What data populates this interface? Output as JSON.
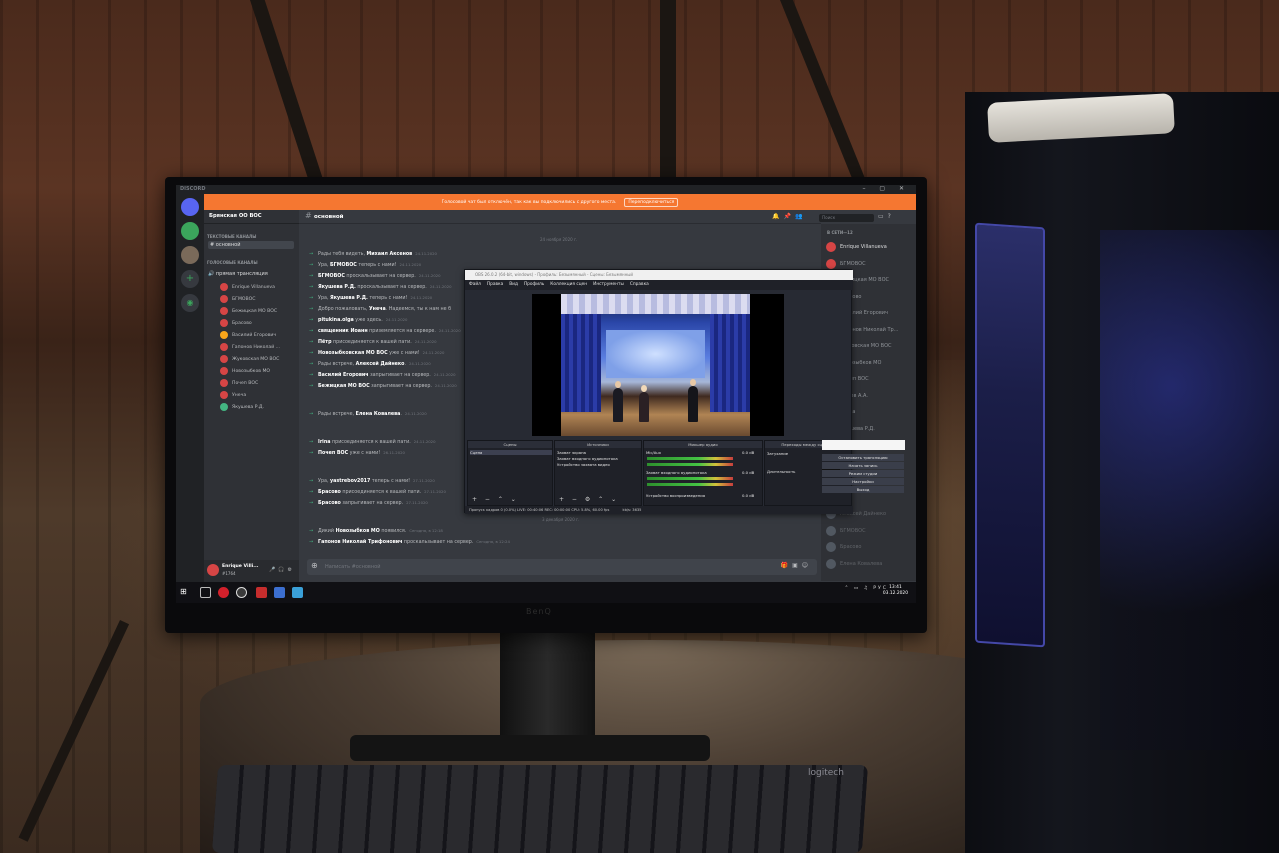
{
  "discord": {
    "brand": "DISCORD",
    "banner_text": "Голосовой чат был отключён, так как вы подключились с другого места.",
    "banner_button": "Переподключиться",
    "server_name": "Брянская ОО ВОС",
    "text_category": "ТЕКСТОВЫЕ КАНАЛЫ",
    "text_channel": "основной",
    "voice_category": "ГОЛОСОВЫЕ КАНАЛЫ",
    "voice_channel": "прямая трансляция",
    "voice_users": [
      "Enrique Villanueva",
      "БГМОВОС",
      "Бежицкая МО ВОС",
      "Брасово",
      "Василий Егорович",
      "Гапонов Николай ...",
      "Жуковская МО ВОС",
      "Новозыбков МО",
      "Почеп ВОС",
      "Унеча",
      "Якушева Р.Д."
    ],
    "user_name": "Enrique Villi...",
    "user_tag": "#1764",
    "channel_title": "основной",
    "search_placeholder": "Поиск",
    "date_divider_1": "24 ноября 2020 г.",
    "date_divider_2": "3 декабря 2020 г.",
    "messages": [
      {
        "pre": "Рады тебя видеть, ",
        "name": "Михаил Аксенов",
        "post": "",
        "ts": "24.11.2020"
      },
      {
        "pre": "Ура, ",
        "name": "БГМОВОС",
        "post": " теперь с нами!",
        "ts": "24.11.2020"
      },
      {
        "pre": "",
        "name": "БГМОВОС",
        "post": " проскальзывает на сервер.",
        "ts": "24.11.2020"
      },
      {
        "pre": "",
        "name": "Якушева Р.Д.",
        "post": " проскальзывает на сервер.",
        "ts": "24.11.2020"
      },
      {
        "pre": "Ура, ",
        "name": "Якушева Р.Д.",
        "post": " теперь с нами!",
        "ts": "24.11.2020"
      },
      {
        "pre": "Добро пожаловать, ",
        "name": "Унеча",
        "post": ". Надеемся, ты к нам не б",
        "ts": ""
      },
      {
        "pre": "",
        "name": "pitukina.olga",
        "post": " уже здесь.",
        "ts": "24.11.2020"
      },
      {
        "pre": "",
        "name": "священник Иоанн",
        "post": " приземляется на сервере.",
        "ts": "24.11.2020"
      },
      {
        "pre": "",
        "name": "Пётр",
        "post": " присоединяется к вашей пати.",
        "ts": "24.11.2020"
      },
      {
        "pre": "",
        "name": "Новозыбковская МО ВОС",
        "post": " уже с нами!",
        "ts": "24.11.2020"
      },
      {
        "pre": "Рады встрече, ",
        "name": "Алексей Дайнеко",
        "post": ".",
        "ts": "24.11.2020"
      },
      {
        "pre": "",
        "name": "Василий Егорович",
        "post": " запрыгивает на сервер.",
        "ts": "24.11.2020"
      },
      {
        "pre": "",
        "name": "Бежицкая МО ВОС",
        "post": " запрыгивает на сервер.",
        "ts": "24.11.2020"
      },
      {
        "pre": "Рады встрече, ",
        "name": "Елена Ковалева",
        "post": ".",
        "ts": "24.11.2020"
      },
      {
        "pre": "",
        "name": "Irina",
        "post": " присоединяется к вашей пати.",
        "ts": "24.11.2020"
      },
      {
        "pre": "",
        "name": "Почеп ВОС",
        "post": " уже с нами!",
        "ts": "26.11.2020"
      },
      {
        "pre": "Ура, ",
        "name": "yastrebov2017",
        "post": " теперь с нами!",
        "ts": "27.11.2020"
      },
      {
        "pre": "",
        "name": "Брасово",
        "post": " присоединяется к вашей пати.",
        "ts": "27.11.2020"
      },
      {
        "pre": "",
        "name": "Брасово",
        "post": " запрыгивает на сервер.",
        "ts": "27.11.2020"
      },
      {
        "pre": "Дикий ",
        "name": "Новозыбков МО",
        "post": " появился.",
        "ts": "Сегодня, в 12:18"
      },
      {
        "pre": "",
        "name": "Гапонов Николай Трифонович",
        "post": " проскальзывает на сервер.",
        "ts": "Сегодня, в 12:24"
      }
    ],
    "input_placeholder": "Написать #основной",
    "members_header": "В СЕТИ—12",
    "members": [
      "Enrique Villanueva",
      "БГМОВОС",
      "Бежицкая МО ВОС",
      "Брасово",
      "Василий Егорович",
      "Гапонов Николай Тр...",
      "Жуковская МО ВОС",
      "Новозыбков МО",
      "Почеп ВОС",
      "Сычев А.А.",
      "Унеча",
      "Якушева Р.Д."
    ],
    "offline_members": [
      "Алексей Дайнеко",
      "БГМОВОС",
      "Брасово",
      "Елена Ковалева"
    ]
  },
  "obs": {
    "title": "OBS 26.0.2 (64-bit, windows) - Профиль: Безымянный - Сцены: Безымянный",
    "menu": [
      "Файл",
      "Правка",
      "Вид",
      "Профиль",
      "Коллекция сцен",
      "Инструменты",
      "Справка"
    ],
    "docks": {
      "scenes": "Сцены",
      "sources": "Источники",
      "mixer": "Микшер аудио",
      "transitions": "Переходы между сценами"
    },
    "scene_item": "Сцена",
    "sources": [
      "Захват экрана",
      "Захват входного аудиопотока",
      "Устройство захвата видео"
    ],
    "mixer_tracks": [
      {
        "name": "Мic/Aux",
        "db": "0.0 dB"
      },
      {
        "name": "Захват входного аудиопотока",
        "db": "0.0 dB"
      },
      {
        "name": "Устройство воспроизведения",
        "db": "0.0 dB"
      }
    ],
    "transition_type": "Затухание",
    "duration_label": "Длительность",
    "duration_value": "300 ms",
    "controls": [
      "Остановить трансляцию",
      "Начать запись",
      "Режим студии",
      "Настройки",
      "Выход"
    ],
    "status": "Пропуск кадров 0 (0.0%)   LIVE: 00:40:06   REC: 00:00:00   CPU: 5.8%, 60.00 fps",
    "bitrate": "kb/s: 3635"
  },
  "taskbar": {
    "tray": "РУС",
    "time": "13:41",
    "date": "03.12.2020"
  },
  "hardware": {
    "keyboard_brand": "logitech"
  }
}
